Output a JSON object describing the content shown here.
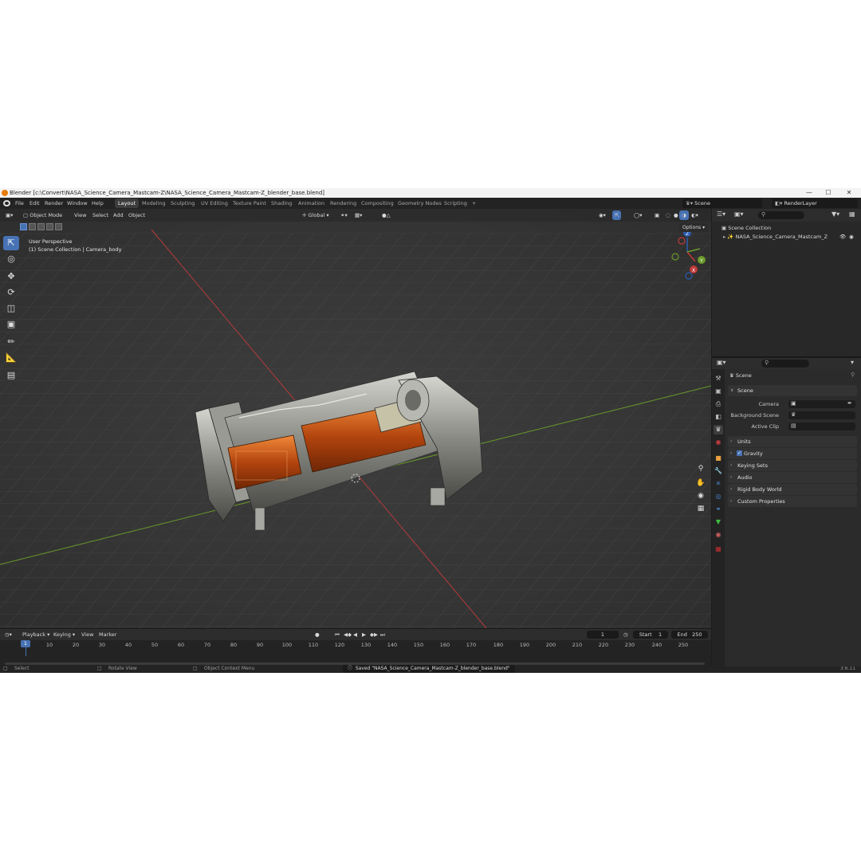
{
  "window": {
    "title": "Blender [c:\\Convert\\NASA_Science_Camera_Mastcam-Z\\NASA_Science_Camera_Mastcam-Z_blender_base.blend]",
    "controls": [
      "—",
      "☐",
      "✕"
    ]
  },
  "menu": {
    "items": [
      "File",
      "Edit",
      "Render",
      "Window",
      "Help"
    ],
    "workspaces": [
      "Layout",
      "Modeling",
      "Sculpting",
      "UV Editing",
      "Texture Paint",
      "Shading",
      "Animation",
      "Rendering",
      "Compositing",
      "Geometry Nodes",
      "Scripting",
      "+"
    ],
    "active_workspace": "Layout",
    "scene": "Scene",
    "view_layer": "RenderLayer"
  },
  "viewport": {
    "mode": "Object Mode",
    "menus": [
      "View",
      "Select",
      "Add",
      "Object"
    ],
    "transform_orientation": "Global",
    "perspective_label": "User Perspective",
    "collection_label": "(1) Scene Collection | Camera_body",
    "options_label": "Options",
    "gizmo_axes": {
      "x": "X",
      "y": "Y",
      "z": "Z"
    },
    "accent_color": "#4772b3",
    "x_axis_color": "#c03a3a",
    "y_axis_color": "#6a9a2a"
  },
  "timeline": {
    "menus": [
      "Playback",
      "Keying",
      "View",
      "Marker"
    ],
    "current_frame": "1",
    "start_label": "Start",
    "start": "1",
    "end_label": "End",
    "end": "250",
    "ticks": [
      "1",
      "10",
      "20",
      "30",
      "40",
      "50",
      "60",
      "70",
      "80",
      "90",
      "100",
      "110",
      "120",
      "130",
      "140",
      "150",
      "160",
      "170",
      "180",
      "190",
      "200",
      "210",
      "220",
      "230",
      "240",
      "250"
    ]
  },
  "statusbar": {
    "select": "Select",
    "rotate": "Rotate View",
    "context_menu": "Object Context Menu",
    "message": "Saved \"NASA_Science_Camera_Mastcam-Z_blender_base.blend\"",
    "version": "3.6.11"
  },
  "outliner": {
    "root": "Scene Collection",
    "items": [
      {
        "name": "NASA_Science_Camera_Mastcam_Z"
      }
    ]
  },
  "properties": {
    "context": "Scene",
    "panels": [
      {
        "title": "Scene",
        "open": true
      },
      {
        "title": "Units",
        "open": false
      },
      {
        "title": "Gravity",
        "open": false,
        "checked": true
      },
      {
        "title": "Keying Sets",
        "open": false
      },
      {
        "title": "Audio",
        "open": false
      },
      {
        "title": "Rigid Body World",
        "open": false
      },
      {
        "title": "Custom Properties",
        "open": false
      }
    ],
    "fields": {
      "camera": "Camera",
      "background_scene": "Background Scene",
      "active_clip": "Active Clip"
    }
  }
}
